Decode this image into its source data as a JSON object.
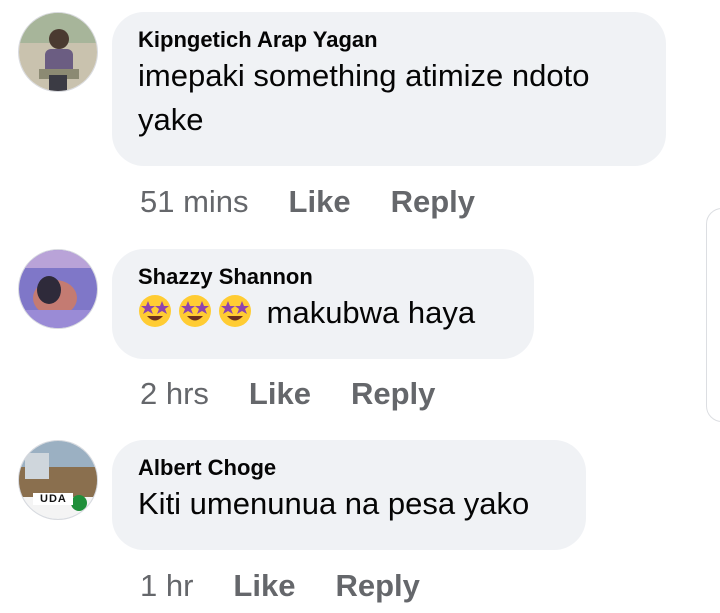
{
  "comments": [
    {
      "author": "Kipngetich Arap Yagan",
      "lines": [
        "imepaki something atimize ndoto",
        "yake"
      ],
      "time": "51 mins",
      "like": "Like",
      "reply": "Reply"
    },
    {
      "author": "Shazzy Shannon",
      "emojis": [
        "star-struck-emoji",
        "star-struck-emoji",
        "star-struck-emoji"
      ],
      "text": "makubwa haya",
      "time": "2 hrs",
      "like": "Like",
      "reply": "Reply"
    },
    {
      "author": "Albert Choge",
      "text": "Kiti umenunua na pesa yako",
      "avatar_badge": "UDA",
      "time": "1 hr",
      "like": "Like",
      "reply": "Reply"
    }
  ],
  "colors": {
    "bubble": "#f0f2f5",
    "text": "#050505",
    "secondary": "#65676b"
  }
}
